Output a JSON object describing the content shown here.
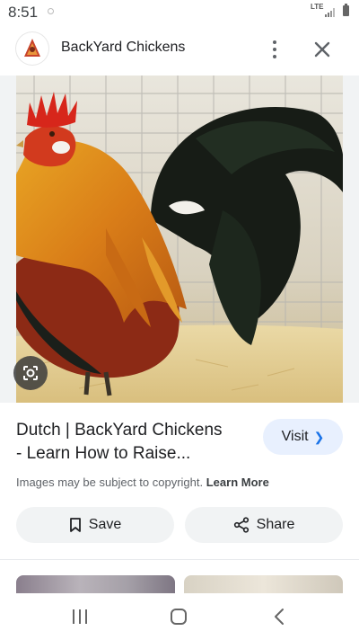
{
  "status_bar": {
    "time": "8:51",
    "network": "LTE"
  },
  "header": {
    "site_name": "BackYard Chickens",
    "logo_icon": "backyard-chickens-logo",
    "more_icon": "more-vert-icon",
    "close_icon": "close-icon"
  },
  "image": {
    "subject": "rooster",
    "lens_icon": "google-lens-icon"
  },
  "result": {
    "title_line1": "Dutch | BackYard Chickens",
    "title_line2": "- Learn How to Raise...",
    "visit_label": "Visit",
    "copyright_text": "Images may be subject to copyright.",
    "learn_more": "Learn More"
  },
  "actions": {
    "save_label": "Save",
    "share_label": "Share"
  },
  "nav": {
    "recents_icon": "recents-icon",
    "home_icon": "home-icon",
    "back_icon": "back-icon"
  },
  "colors": {
    "visit_bg": "#e8f0fe",
    "button_bg": "#f1f3f4",
    "accent": "#1a73e8"
  }
}
